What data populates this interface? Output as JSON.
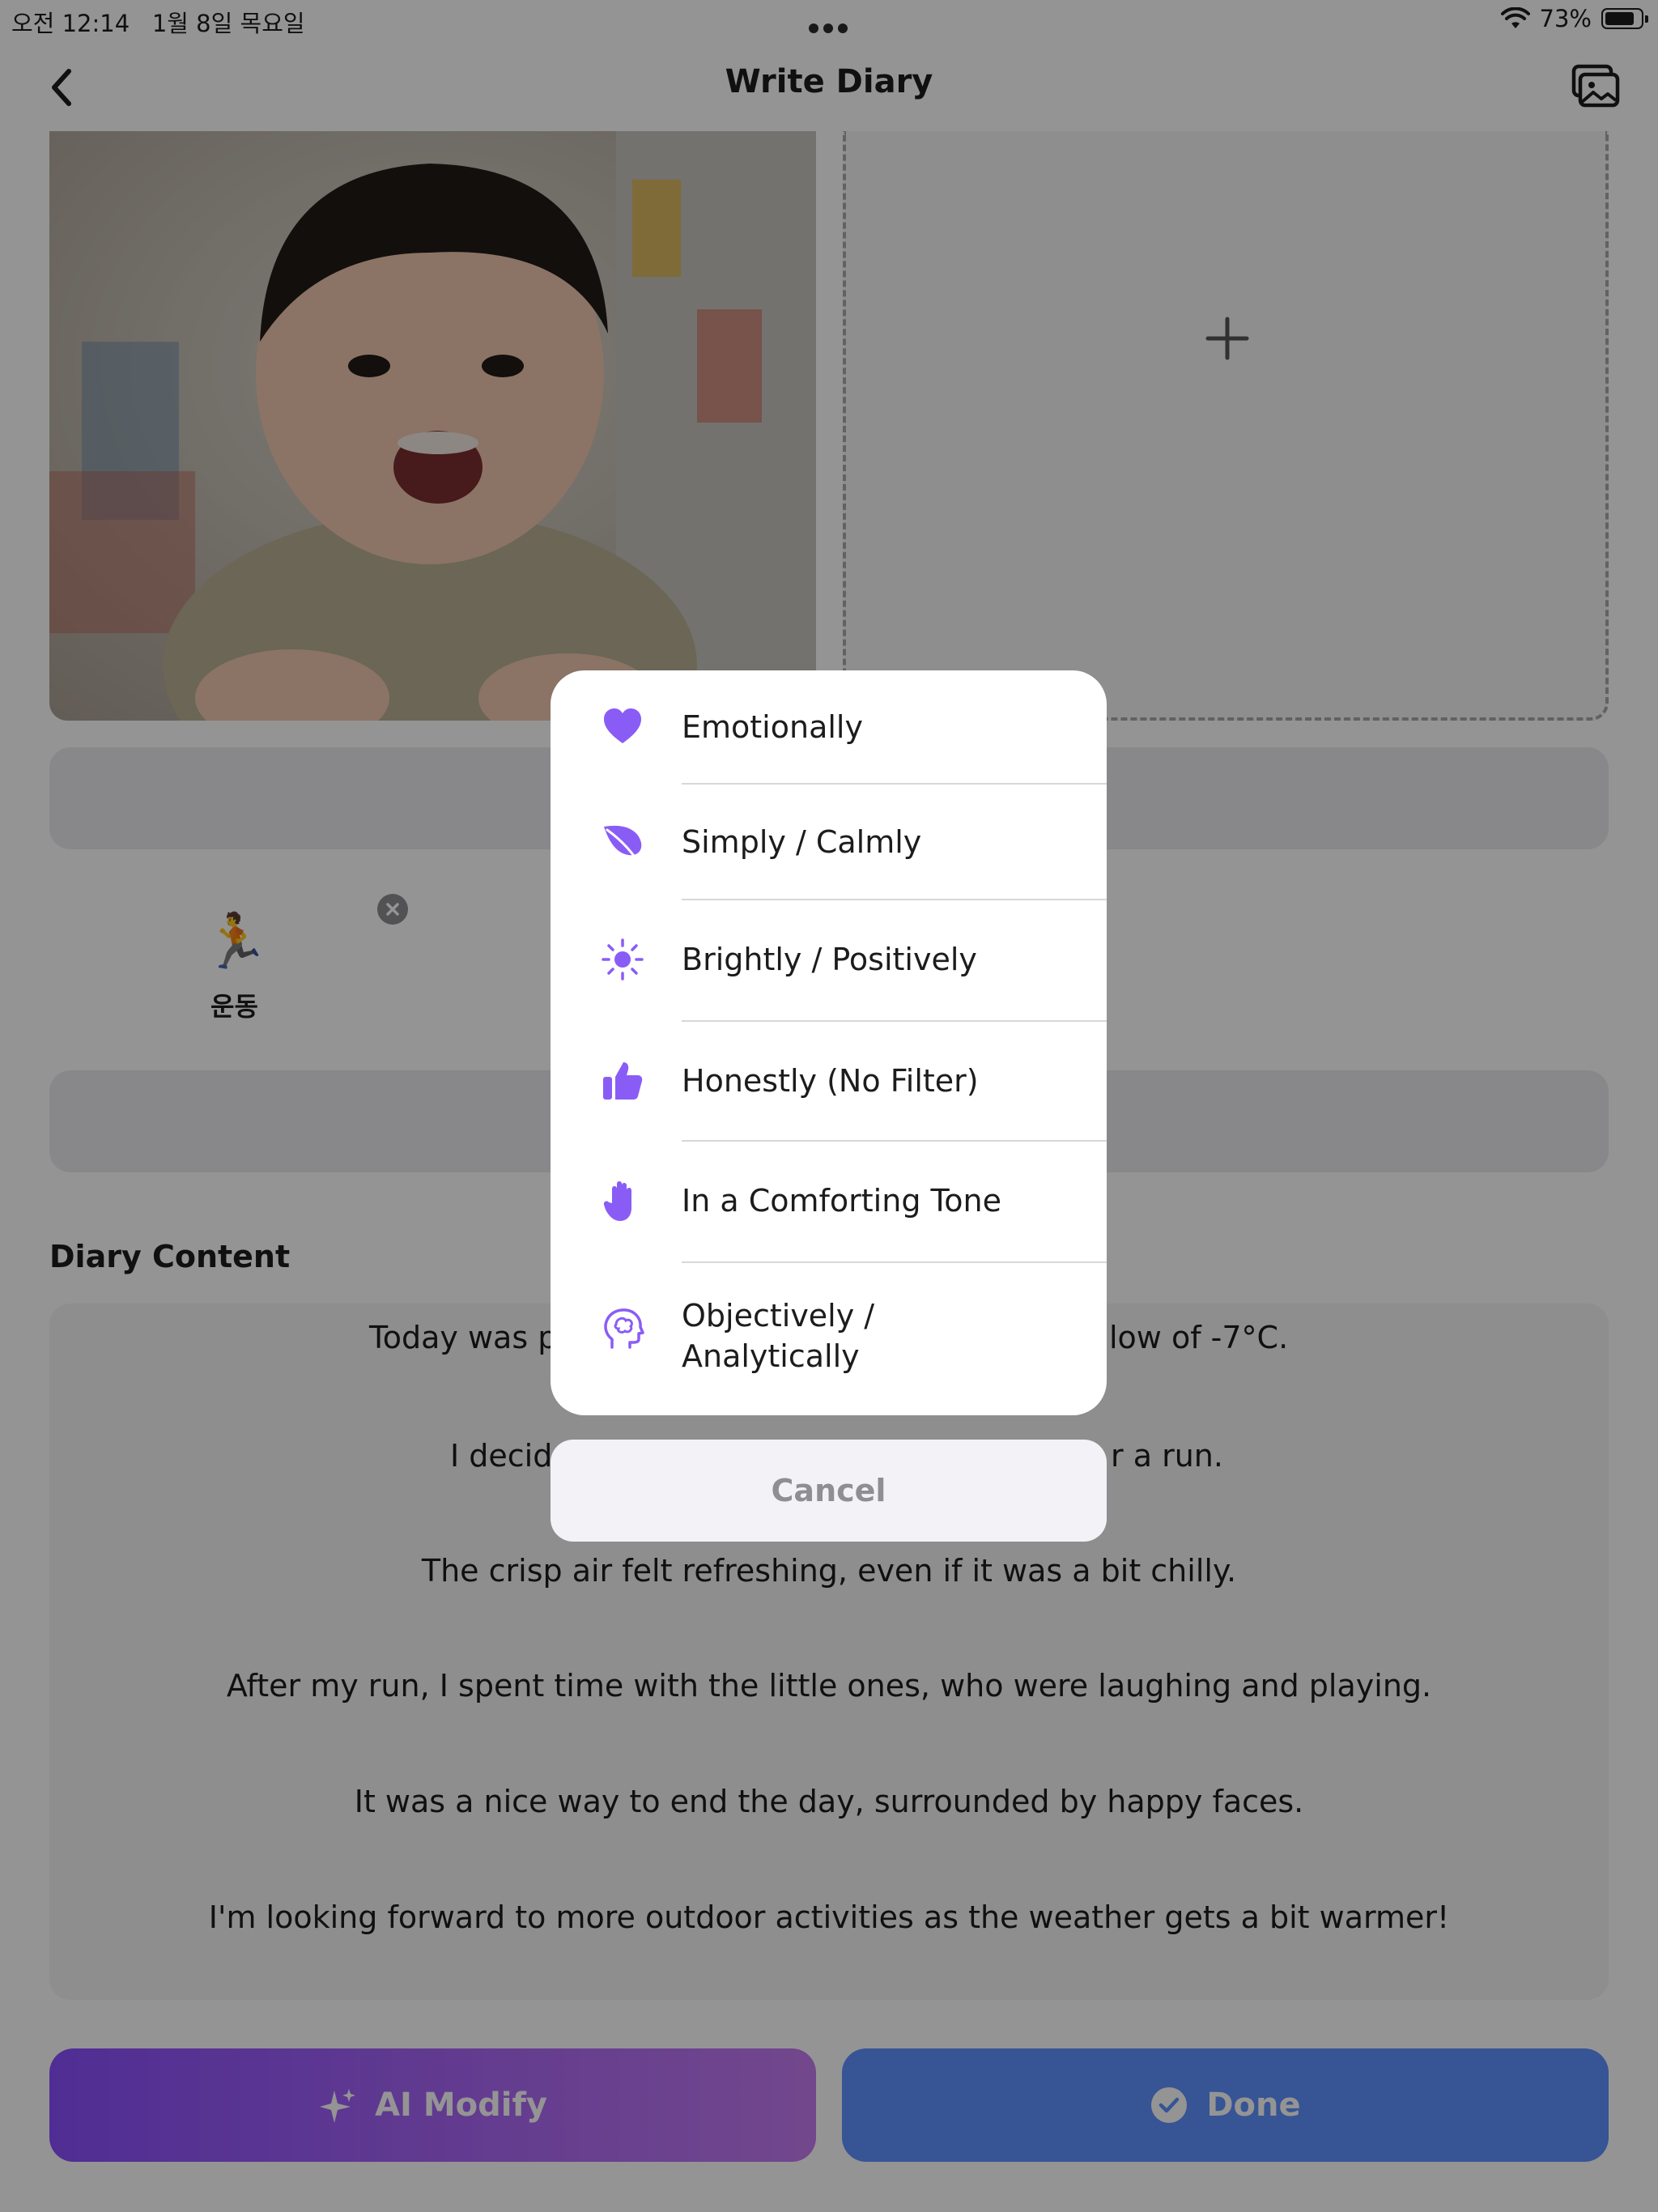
{
  "status_bar": {
    "time": "오전 12:14",
    "date": "1월 8일 목요일",
    "battery": "73%"
  },
  "header": {
    "title": "Write Diary"
  },
  "activity": {
    "emoji": "🏃",
    "label": "운동"
  },
  "diary": {
    "heading": "Diary Content",
    "lines": [
      "Today was p",
      "I decid",
      "The crisp air felt refreshing, even if it was a bit chilly.",
      "After my run, I spent time with the little ones, who were laughing and playing.",
      "It was a nice way to end the day, surrounded by happy faces.",
      "I'm looking forward to more outdoor activities as the weather gets a bit warmer!"
    ],
    "fragments": {
      "line1_right": "low of -7°C.",
      "line2_right": "r a run."
    }
  },
  "buttons": {
    "ai_modify": "AI Modify",
    "done": "Done"
  },
  "tone_sheet": {
    "options": [
      {
        "label": "Emotionally",
        "icon": "heart-icon"
      },
      {
        "label": "Simply / Calmly",
        "icon": "leaf-icon"
      },
      {
        "label": "Brightly / Positively",
        "icon": "sun-icon"
      },
      {
        "label": "Honestly (No Filter)",
        "icon": "thumbs-up-icon"
      },
      {
        "label": "In a Comforting Tone",
        "icon": "hand-icon"
      },
      {
        "label": "Objectively /",
        "label2": "Analytically",
        "icon": "brain-head-icon"
      }
    ],
    "cancel": "Cancel"
  },
  "colors": {
    "accent": "#8a5cf6",
    "ai_gradient_start": "#8a4fff",
    "ai_gradient_end": "#c57bf2",
    "done_blue": "#5f92ff"
  }
}
